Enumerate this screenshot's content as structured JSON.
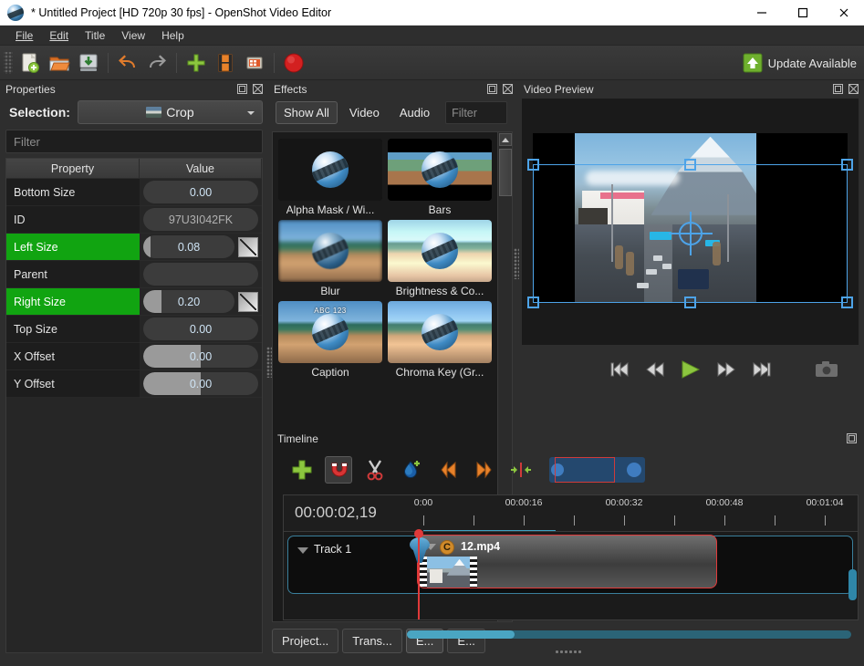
{
  "window": {
    "title": "* Untitled Project [HD 720p 30 fps] - OpenShot Video Editor",
    "minimize": "minimize-button",
    "maximize": "maximize-button",
    "close": "close-button"
  },
  "menubar": {
    "items": [
      "File",
      "Edit",
      "Title",
      "View",
      "Help"
    ]
  },
  "toolbar": {
    "buttons": [
      "new-project-icon",
      "open-project-icon",
      "save-project-icon",
      "undo-icon",
      "redo-icon",
      "import-files-icon",
      "add-track-icon",
      "fullscreen-icon",
      "export-video-icon"
    ],
    "update_label": "Update Available"
  },
  "properties": {
    "panel_title": "Properties",
    "selection_label": "Selection:",
    "selection_value": "Crop",
    "filter_placeholder": "Filter",
    "columns": [
      "Property",
      "Value"
    ],
    "rows": [
      {
        "name": "Bottom Size",
        "value": "0.00",
        "highlight": false,
        "fill_pct": 0,
        "keyframe": false,
        "bare": false
      },
      {
        "name": "ID",
        "value": "97U3I042FK",
        "highlight": false,
        "fill_pct": 0,
        "keyframe": false,
        "bare": true
      },
      {
        "name": "Left Size",
        "value": "0.08",
        "highlight": true,
        "fill_pct": 8,
        "keyframe": true,
        "bare": false
      },
      {
        "name": "Parent",
        "value": "",
        "highlight": false,
        "fill_pct": 0,
        "keyframe": false,
        "bare": true
      },
      {
        "name": "Right Size",
        "value": "0.20",
        "highlight": true,
        "fill_pct": 20,
        "keyframe": true,
        "bare": false
      },
      {
        "name": "Top Size",
        "value": "0.00",
        "highlight": false,
        "fill_pct": 0,
        "keyframe": false,
        "bare": false
      },
      {
        "name": "X Offset",
        "value": "0.00",
        "highlight": false,
        "fill_pct": 50,
        "keyframe": false,
        "bare": false
      },
      {
        "name": "Y Offset",
        "value": "0.00",
        "highlight": false,
        "fill_pct": 50,
        "keyframe": false,
        "bare": false
      }
    ]
  },
  "effects": {
    "panel_title": "Effects",
    "buttons": {
      "show_all": "Show All",
      "video": "Video",
      "audio": "Audio"
    },
    "filter_placeholder": "Filter",
    "items": [
      {
        "label": "Alpha Mask / Wi...",
        "style": "dark"
      },
      {
        "label": "Bars",
        "style": "bars"
      },
      {
        "label": "Blur",
        "style": "blurry"
      },
      {
        "label": "Brightness & Co...",
        "style": "bright"
      },
      {
        "label": "Caption",
        "style": "caption",
        "overlay": "ABC 123"
      },
      {
        "label": "Chroma Key (Gr...",
        "style": "chroma"
      }
    ],
    "tabs": [
      "Project...",
      "Trans...",
      "E...",
      "E..."
    ],
    "selected_tab_index": 2
  },
  "preview": {
    "panel_title": "Video Preview",
    "transport": [
      "skip-to-start-icon",
      "rewind-icon",
      "play-icon",
      "fast-forward-icon",
      "skip-to-end-icon"
    ],
    "snapshot": "snapshot-camera-icon"
  },
  "timeline": {
    "panel_title": "Timeline",
    "tools": [
      "add-marker-icon",
      "snapping-magnet-icon",
      "razor-tool-icon",
      "add-keyframe-icon",
      "previous-marker-icon",
      "next-marker-icon",
      "center-playhead-icon"
    ],
    "timecode": "00:00:02,19",
    "ruler_labels": [
      "0:00",
      "00:00:16",
      "00:00:32",
      "00:00:48",
      "00:01:04"
    ],
    "track_name": "Track 1",
    "clip": {
      "title": "12.mp4",
      "badge": "C"
    }
  }
}
